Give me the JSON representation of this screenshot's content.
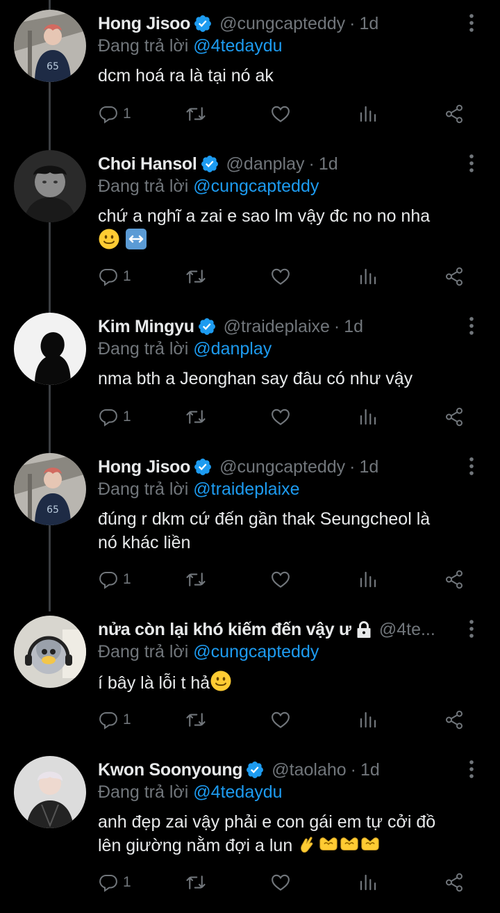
{
  "reply_prefix": "Đang trả lời",
  "tweets": [
    {
      "name": "Hong Jisoo",
      "handle": "@cungcapteddy",
      "time": "1d",
      "reply_to": "@4tedaydu",
      "text_lines": [
        "dcm hoá ra là tại nó ak"
      ],
      "reply_count": "1",
      "verified": true,
      "avatar": "avatar-photo"
    },
    {
      "name": "Choi Hansol",
      "handle": "@danplay",
      "time": "1d",
      "reply_to": "@cungcapteddy",
      "text_lines": [
        "chứ a nghĩ a zai e sao lm vậy đc no no nha"
      ],
      "reply_count": "1",
      "verified": true,
      "avatar": "avatar-photo"
    },
    {
      "name": "Kim Mingyu",
      "handle": "@traideplaixe",
      "time": "1d",
      "reply_to": "@danplay",
      "text_lines": [
        "nma bth a Jeonghan say đâu có như vậy"
      ],
      "reply_count": "1",
      "verified": true,
      "avatar": "avatar-silhouette"
    },
    {
      "name": "Hong Jisoo",
      "handle": "@cungcapteddy",
      "time": "1d",
      "reply_to": "@traideplaixe",
      "text_lines": [
        "đúng r dkm cứ đến gần thak Seungcheol là",
        "nó khác liền"
      ],
      "reply_count": "1",
      "verified": true,
      "avatar": "avatar-photo"
    },
    {
      "name": "nửa còn lại khó kiếm đến vậy ư",
      "handle": "@4te...",
      "time": "",
      "reply_to": "@cungcapteddy",
      "text_lines": [
        "í bây là lỗi t hả"
      ],
      "reply_count": "1",
      "verified": false,
      "locked": true,
      "avatar": "avatar-photo"
    },
    {
      "name": "Kwon Soonyoung",
      "handle": "@taolaho",
      "time": "1d",
      "reply_to": "@4tedaydu",
      "text_lines": [
        "anh đẹp zai vậy phải e con gái em tự cởi đồ",
        "lên giường nằm đợi a lun"
      ],
      "reply_count": "1",
      "verified": true,
      "avatar": "avatar-photo"
    }
  ],
  "colors": {
    "background": "#000000",
    "text": "#e7e9ea",
    "muted": "#71767b",
    "link": "#1d9bf0",
    "verified_badge": "#1d9bf0"
  },
  "icons": [
    "reply-icon",
    "retweet-icon",
    "like-icon",
    "views-icon",
    "share-icon",
    "more-icon",
    "verified-icon",
    "lock-icon"
  ]
}
